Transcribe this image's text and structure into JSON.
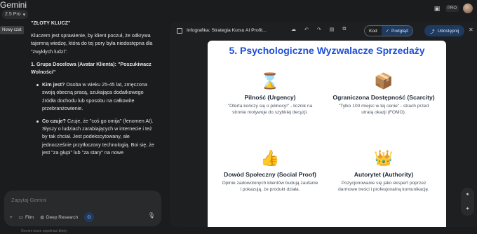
{
  "app": {
    "title": "Gemini",
    "model": "2.5 Pro",
    "tooltip": "Nowy czat",
    "pro_badge": "PRO"
  },
  "chat": {
    "heading": "\"ZŁOTY KLUCZ\"",
    "intro": "Kluczem jest sprawienie, by klient poczuł, że odkrywa tajemną wiedzę, która do tej pory była niedostępna dla \"zwykłych ludzi\".",
    "section_title": "1. Grupa Docelowa (Avatar Klienta): \"Poszukiwacz Wolności\"",
    "bullets": [
      {
        "label": "Kim jest?",
        "text": " Osoba w wieku 25-45 lat, zmęczona swoją obecną pracą, szukająca dodatkowego źródła dochodu lub sposobu na całkowite przebranżowienie."
      },
      {
        "label": "Co czuje?",
        "text": " Czuje, że \"coś go omija\" (fenomen AI). Słyszy o ludziach zarabiających w internecie i też by tak chciał. Jest podekscytowany, ale jednocześnie przytłoczony technologią. Boi się, że jest \"za głupi\" lub \"za stary\" na nowe"
      }
    ]
  },
  "prompt": {
    "placeholder": "Zapytaj Gemini",
    "tools": {
      "plus": "+",
      "film": "Film",
      "deep_research": "Deep Research"
    }
  },
  "disclaimer": "Gemini może popełniać błędy",
  "panel": {
    "title": "Infografika: Strategia Kursu AI Profit...",
    "code_label": "Kod",
    "preview_label": "Podgląd",
    "share_label": "Udostępnij"
  },
  "infographic": {
    "header": "5. Psychologiczne Wyzwalacze Sprzedaży",
    "triggers": [
      {
        "emoji": "⌛",
        "title": "Pilność (Urgency)",
        "desc": "\"Oferta kończy się o północy!\" - licznik na stronie motywuje do szybkiej decyzji."
      },
      {
        "emoji": "📦",
        "title": "Ograniczona Dostępność (Scarcity)",
        "desc": "\"Tylko 100 miejsc w tej cenie\" - strach przed utratą okazji (FOMO)."
      },
      {
        "emoji": "👍",
        "title": "Dowód Społeczny (Social Proof)",
        "desc": "Opinie zadowolonych klientów budują zaufanie i pokazują, że produkt działa."
      },
      {
        "emoji": "👑",
        "title": "Autorytet (Authority)",
        "desc": "Pozycjonowanie się jako ekspert poprzez darmowe treści i profesjonalną komunikację."
      }
    ]
  },
  "colors": {
    "accent": "#1d4ed8",
    "share_bg": "#1f3a5f",
    "bg": "#1b1c1d"
  }
}
